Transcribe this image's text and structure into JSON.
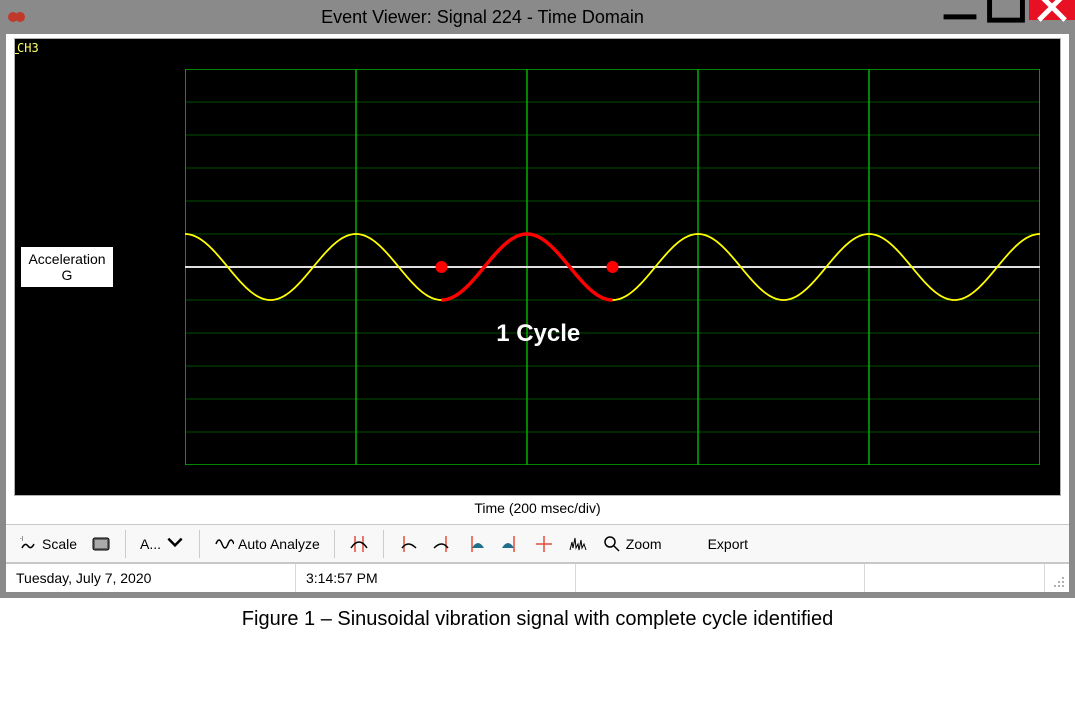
{
  "window": {
    "title": "Event Viewer: Signal  224  - Time Domain"
  },
  "plot": {
    "channel": "CH3",
    "y_label_line1": "Acceleration",
    "y_label_line2": "G",
    "x_label": "Time (200 msec/div)",
    "x_min": "0",
    "x_max": "1000",
    "cycle_annotation": "1 Cycle"
  },
  "toolbar": {
    "scale_label": "Scale",
    "a_label": "A...",
    "auto_analyze_label": "Auto Analyze",
    "zoom_label": "Zoom",
    "export_label": "Export"
  },
  "status": {
    "date": "Tuesday, July 7, 2020",
    "time": "3:14:57 PM"
  },
  "caption": "Figure 1 – Sinusoidal vibration signal with complete cycle identified",
  "chart_data": {
    "type": "line",
    "title": "Event Viewer: Signal 224 - Time Domain",
    "xlabel": "Time (200 msec/div)",
    "ylabel": "Acceleration G",
    "xlim": [
      0,
      1000
    ],
    "ylim": [
      -6,
      6
    ],
    "x_ticks": [
      0,
      200,
      400,
      600,
      800,
      1000
    ],
    "y_ticks": [
      -6,
      -5,
      -4,
      -3,
      -2,
      -1,
      0,
      1,
      2,
      3,
      4,
      5,
      6
    ],
    "series": [
      {
        "name": "CH3",
        "color": "#ffff00",
        "function": "sin",
        "amplitude": 1.0,
        "period_ms": 200,
        "phase_deg": 90,
        "x_range": [
          0,
          1000
        ]
      }
    ],
    "highlight": {
      "name": "1 Cycle",
      "color": "#ff0000",
      "x_range": [
        300,
        500
      ],
      "markers": [
        {
          "x": 300,
          "y": 0
        },
        {
          "x": 500,
          "y": 0
        }
      ]
    },
    "annotations": [
      {
        "text": "1 Cycle",
        "x": 420,
        "y": -2,
        "color": "#fff",
        "bold": true
      }
    ]
  }
}
